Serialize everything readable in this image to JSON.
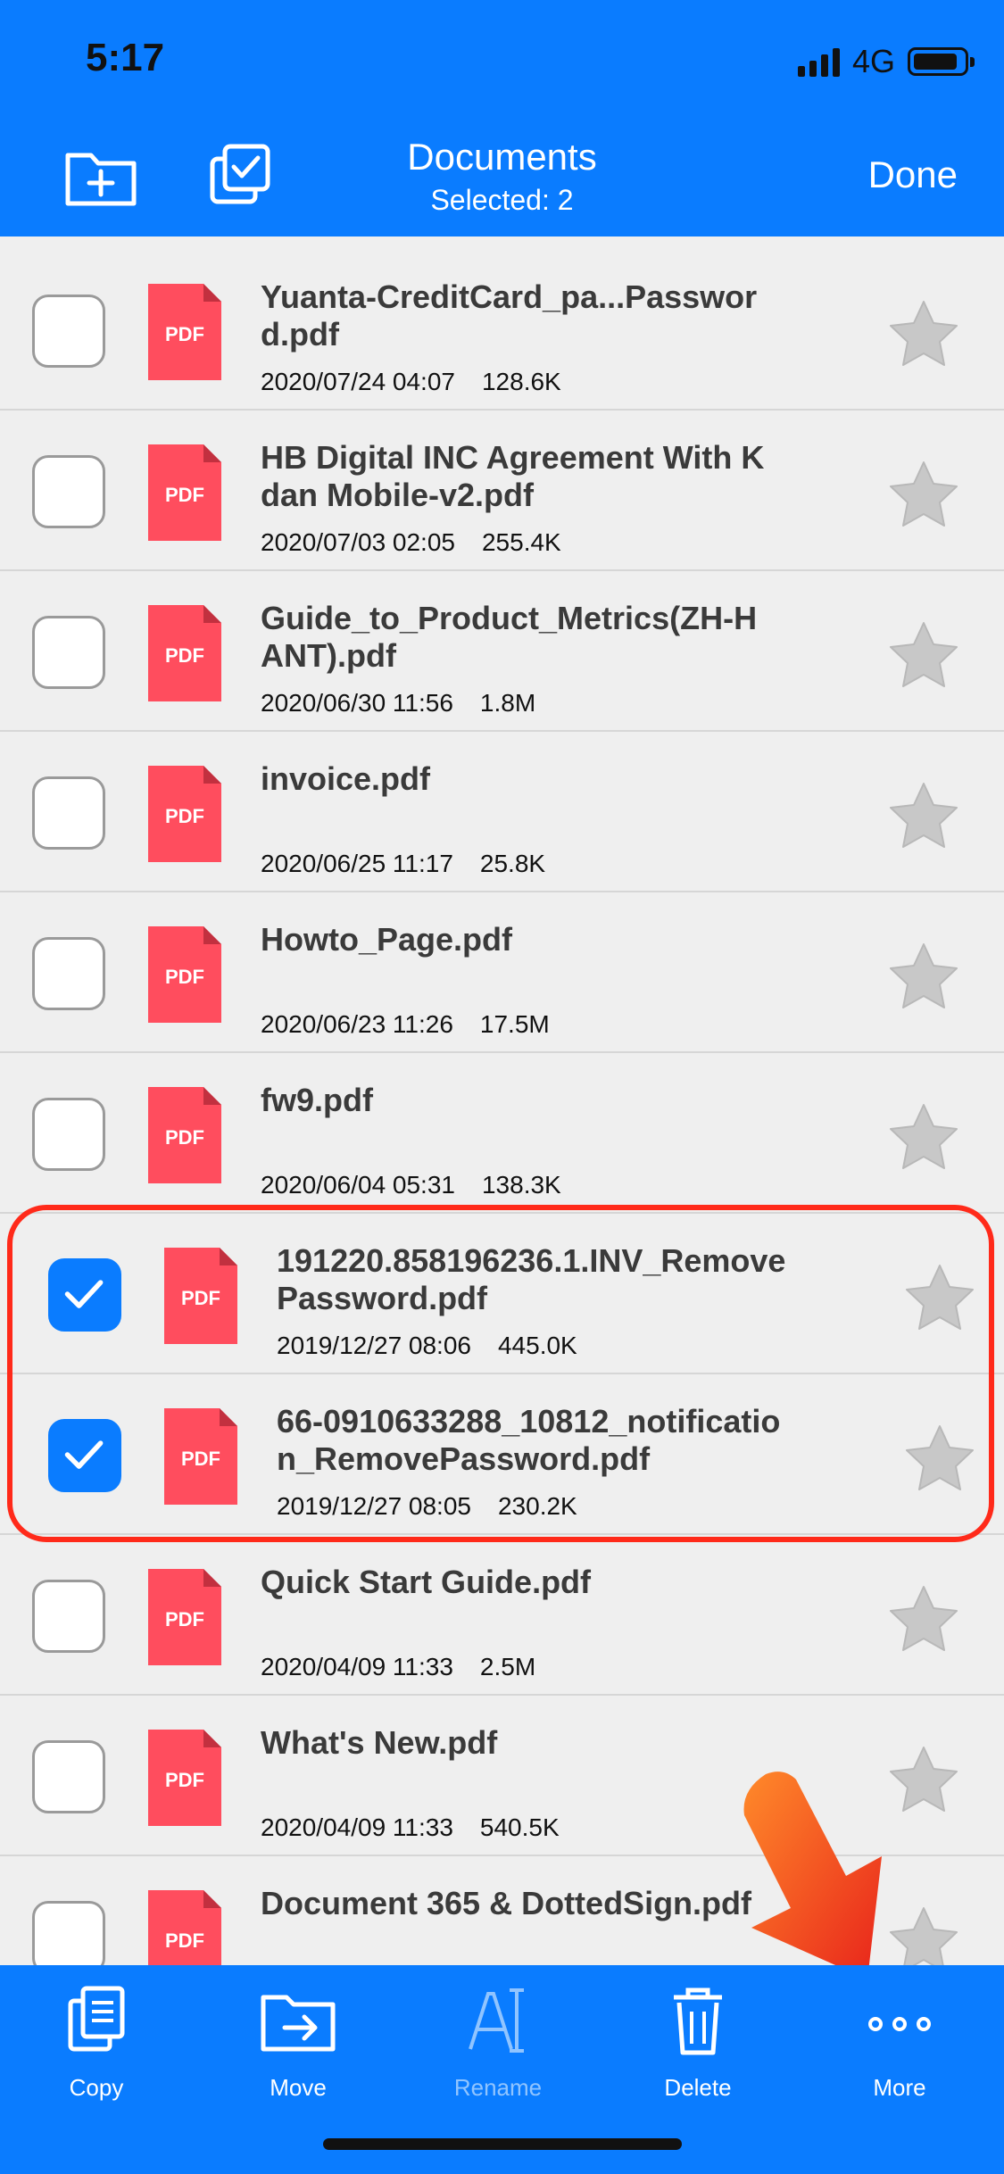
{
  "status": {
    "time": "5:17",
    "network": "4G"
  },
  "header": {
    "title": "Documents",
    "subtitle": "Selected: 2",
    "done_label": "Done"
  },
  "files": [
    {
      "name": "Yuanta-CreditCard_pa...Password.pdf",
      "date": "2020/07/24 04:07",
      "size": "128.6K",
      "selected": false
    },
    {
      "name": "HB Digital INC Agreement With Kdan Mobile-v2.pdf",
      "date": "2020/07/03 02:05",
      "size": "255.4K",
      "selected": false
    },
    {
      "name": "Guide_to_Product_Metrics(ZH-HANT).pdf",
      "date": "2020/06/30 11:56",
      "size": "1.8M",
      "selected": false
    },
    {
      "name": "invoice.pdf",
      "date": "2020/06/25 11:17",
      "size": "25.8K",
      "selected": false
    },
    {
      "name": "Howto_Page.pdf",
      "date": "2020/06/23 11:26",
      "size": "17.5M",
      "selected": false
    },
    {
      "name": "fw9.pdf",
      "date": "2020/06/04 05:31",
      "size": "138.3K",
      "selected": false
    },
    {
      "name": "191220.858196236.1.INV_RemovePassword.pdf",
      "date": "2019/12/27 08:06",
      "size": "445.0K",
      "selected": true
    },
    {
      "name": "66-0910633288_10812_notification_RemovePassword.pdf",
      "date": "2019/12/27 08:05",
      "size": "230.2K",
      "selected": true
    },
    {
      "name": "Quick Start Guide.pdf",
      "date": "2020/04/09 11:33",
      "size": "2.5M",
      "selected": false
    },
    {
      "name": "What's New.pdf",
      "date": "2020/04/09 11:33",
      "size": "540.5K",
      "selected": false
    },
    {
      "name": "Document 365 & DottedSign.pdf",
      "date": "",
      "size": "",
      "selected": false
    }
  ],
  "file_badge": "PDF",
  "toolbar": {
    "copy": "Copy",
    "move": "Move",
    "rename": "Rename",
    "delete": "Delete",
    "more": "More"
  },
  "colors": {
    "accent": "#0a7cff",
    "pdf": "#ff4d5e",
    "highlight": "#ff2a1a"
  }
}
